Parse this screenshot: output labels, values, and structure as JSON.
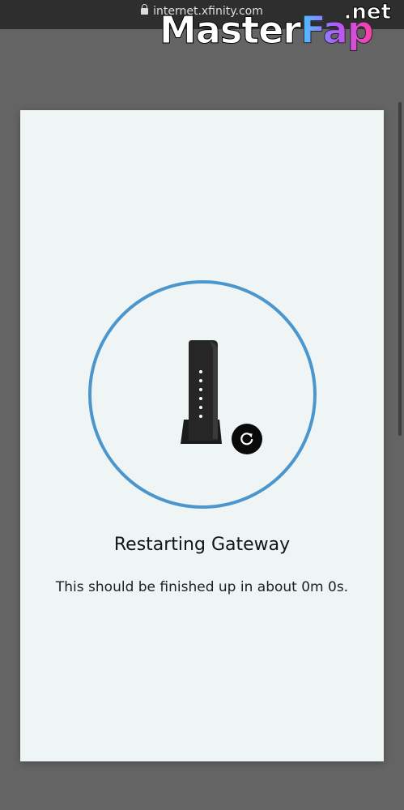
{
  "browser": {
    "url": "internet.xfinity.com"
  },
  "watermark": {
    "brand_part1": "Master",
    "brand_part2": "Fap",
    "tld": ".net"
  },
  "status": {
    "title": "Restarting Gateway",
    "message": "This should be finished up in about 0m 0s."
  },
  "colors": {
    "ring": "#4b97cd",
    "card_background": "#eff4f5",
    "page_background": "#646464"
  },
  "icons": {
    "device": "gateway-modem-icon",
    "status": "refresh-icon"
  }
}
